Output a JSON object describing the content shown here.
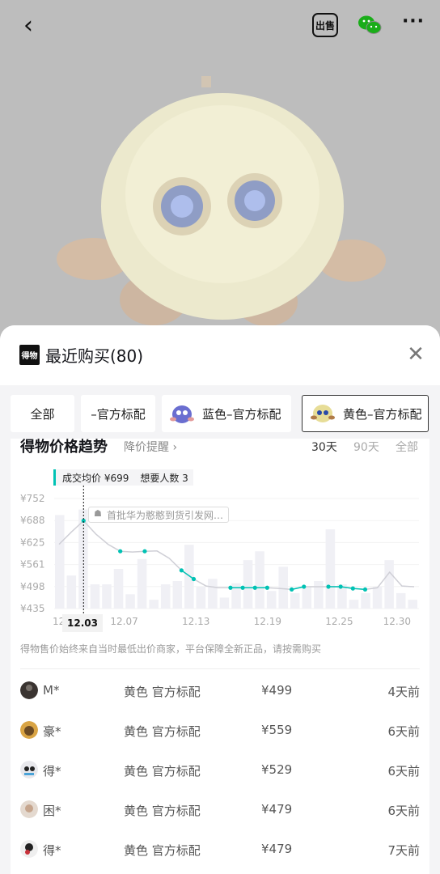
{
  "topbar": {
    "sell_label": "出售"
  },
  "sheet": {
    "logo_text": "得物",
    "title": "最近购买(80)"
  },
  "tabs": [
    {
      "label": "全部"
    },
    {
      "label": "–官方标配"
    },
    {
      "label": "蓝色–官方标配"
    },
    {
      "label": "黄色–官方标配"
    }
  ],
  "trend": {
    "title": "得物价格趋势",
    "remind": "降价提醒 ›",
    "ranges": [
      "30天",
      "90天",
      "全部"
    ],
    "avg_label": "成交均价 ¥699",
    "want_label": "想要人数 3",
    "annotation": "首批华为憨憨到货引发网…",
    "selected_date": "12.03",
    "note": "得物售价始终来自当时最低出价商家，平台保障全新正品，请按需购买"
  },
  "chart_data": {
    "type": "line",
    "x": [
      "12.01",
      "12.02",
      "12.03",
      "12.04",
      "12.05",
      "12.06",
      "12.07",
      "12.08",
      "12.09",
      "12.10",
      "12.11",
      "12.12",
      "12.13",
      "12.14",
      "12.15",
      "12.16",
      "12.17",
      "12.18",
      "12.19",
      "12.20",
      "12.21",
      "12.22",
      "12.23",
      "12.24",
      "12.25",
      "12.26",
      "12.27",
      "12.28",
      "12.29",
      "12.30"
    ],
    "x_ticks": [
      "12",
      "12.07",
      "12.13",
      "12.19",
      "12.25",
      "12.30"
    ],
    "y_ticks": [
      "¥752",
      "¥688",
      "¥625",
      "¥561",
      "¥498",
      "¥435"
    ],
    "ylim": [
      435,
      752
    ],
    "series": [
      {
        "values": [
          620,
          655,
          688,
          650,
          620,
          600,
          598,
          600,
          601,
          580,
          545,
          520,
          500,
          495,
          495,
          495,
          495,
          495,
          493,
          490,
          498,
          498,
          498,
          498,
          493,
          490,
          495,
          540,
          500,
          498
        ]
      }
    ],
    "highlight_points": [
      2,
      5,
      7,
      10,
      11,
      14,
      15,
      16,
      17,
      19,
      20,
      22,
      23,
      24,
      25
    ],
    "bars": [
      0.85,
      0.3,
      0.9,
      0.22,
      0.22,
      0.36,
      0.13,
      0.45,
      0.08,
      0.22,
      0.25,
      0.58,
      0.2,
      0.27,
      0.1,
      0.23,
      0.44,
      0.52,
      0.16,
      0.38,
      0.14,
      0.2,
      0.25,
      0.72,
      0.22,
      0.08,
      0.14,
      0.2,
      0.44,
      0.14,
      0.08
    ]
  },
  "purchases": [
    {
      "user": "M*",
      "sku": "黄色 官方标配",
      "price": "¥499",
      "time": "4天前"
    },
    {
      "user": "豪*",
      "sku": "黄色 官方标配",
      "price": "¥559",
      "time": "6天前"
    },
    {
      "user": "得*",
      "sku": "黄色 官方标配",
      "price": "¥529",
      "time": "6天前"
    },
    {
      "user": "困*",
      "sku": "黄色 官方标配",
      "price": "¥479",
      "time": "6天前"
    },
    {
      "user": "得*",
      "sku": "黄色 官方标配",
      "price": "¥479",
      "time": "7天前"
    }
  ],
  "colors": {
    "accent": "#00c2b4",
    "bar": "#f0f0f5",
    "line": "#cfcfd6"
  }
}
